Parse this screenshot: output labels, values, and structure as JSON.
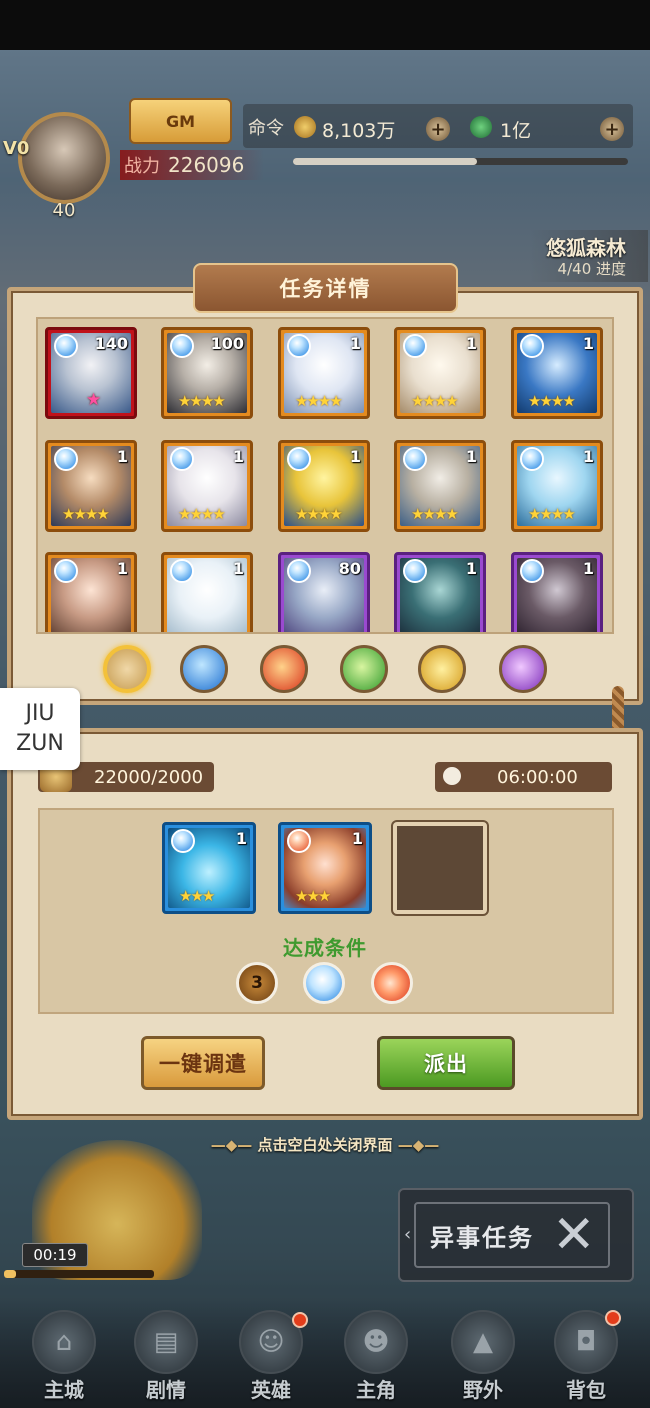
{
  "hud": {
    "vip": "V0",
    "level": "40",
    "gm_label": "GM",
    "power_label": "战力",
    "power_value": "226096",
    "command_label": "命令",
    "gold_value": "8,103万",
    "jade_value": "1亿",
    "xp_fraction": 0.55,
    "stage_name": "悠狐森林",
    "stage_progress": "4/40 进度"
  },
  "task_panel": {
    "title": "任务详情",
    "heroes": [
      {
        "level": "140",
        "frame": "red",
        "element": "water",
        "stars": "",
        "special_star": "★"
      },
      {
        "level": "100",
        "frame": "orange",
        "element": "water",
        "stars": "★★★★",
        "special_star": ""
      },
      {
        "level": "1",
        "frame": "orange",
        "element": "water",
        "stars": "★★★★",
        "special_star": ""
      },
      {
        "level": "1",
        "frame": "orange",
        "element": "water",
        "stars": "★★★★",
        "special_star": ""
      },
      {
        "level": "1",
        "frame": "orange",
        "element": "water",
        "stars": "★★★★",
        "special_star": ""
      },
      {
        "level": "1",
        "frame": "orange",
        "element": "water",
        "stars": "★★★★",
        "special_star": ""
      },
      {
        "level": "1",
        "frame": "orange",
        "element": "water",
        "stars": "★★★★",
        "special_star": ""
      },
      {
        "level": "1",
        "frame": "orange",
        "element": "water",
        "stars": "★★★★",
        "special_star": ""
      },
      {
        "level": "1",
        "frame": "orange",
        "element": "water",
        "stars": "★★★★",
        "special_star": ""
      },
      {
        "level": "1",
        "frame": "orange",
        "element": "water",
        "stars": "★★★★",
        "special_star": ""
      },
      {
        "level": "1",
        "frame": "orange",
        "element": "water",
        "stars": "",
        "special_star": ""
      },
      {
        "level": "1",
        "frame": "orange",
        "element": "water",
        "stars": "",
        "special_star": ""
      },
      {
        "level": "80",
        "frame": "purple",
        "element": "water",
        "stars": "",
        "special_star": ""
      },
      {
        "level": "1",
        "frame": "purple",
        "element": "water",
        "stars": "",
        "special_star": ""
      },
      {
        "level": "1",
        "frame": "purple",
        "element": "water",
        "stars": "",
        "special_star": ""
      }
    ],
    "element_filters": [
      "all",
      "water",
      "fire",
      "wind",
      "light",
      "dark"
    ],
    "selected_filter": "all"
  },
  "dispatch": {
    "reward_value": "22000/2000",
    "time_value": "06:00:00",
    "slots": [
      {
        "level": "1",
        "element": "water",
        "stars": "★★★",
        "frame": "blue"
      },
      {
        "level": "1",
        "element": "fire",
        "stars": "★★★",
        "frame": "blue"
      },
      {
        "empty": true
      }
    ],
    "condition_label": "达成条件",
    "conditions": [
      "3",
      "water",
      "fire"
    ],
    "auto_button": "一键调遣",
    "send_button": "派出"
  },
  "close_hint": "点击空白处关闭界面",
  "event": {
    "timer": "00:19",
    "timer_fraction": 0.08,
    "title": "异事任务"
  },
  "nav": [
    "主城",
    "剧情",
    "英雄",
    "主角",
    "野外",
    "背包"
  ],
  "overlay_badge": "JIU\nZUN",
  "colors": {
    "panel_bg": "#e9dcc2",
    "title_bar": "#9a6339",
    "condition_green": "#3f9a2f",
    "send_green": "#6fb63a",
    "auto_gold": "#e6b55c"
  }
}
